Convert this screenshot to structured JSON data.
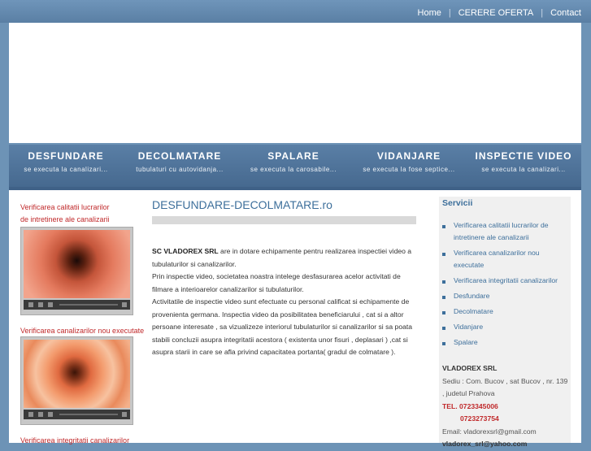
{
  "topnav": {
    "home": "Home",
    "cerere": "CERERE OFERTA",
    "contact": "Contact"
  },
  "nav": [
    {
      "title": "DESFUNDARE",
      "sub": "se executa la canalizari..."
    },
    {
      "title": "DECOLMATARE",
      "sub": "tubulaturi cu autovidanja..."
    },
    {
      "title": "SPALARE",
      "sub": "se executa la carosabile..."
    },
    {
      "title": "VIDANJARE",
      "sub": "se executa la fose septice..."
    },
    {
      "title": "INSPECTIE VIDEO",
      "sub": "se executa la canalizari..."
    }
  ],
  "left": {
    "video1_line1": "Verificarea calitatii lucrarilor",
    "video1_line2": "de intretinere ale canalizarii",
    "video2": "Verificarea canalizarilor nou executate",
    "video3": "Verificarea integritatii canalizarilor"
  },
  "main": {
    "heading": "DESFUNDARE-DECOLMATARE.ro",
    "company": "SC VLADOREX SRL",
    "p1": " are in dotare echipamente pentru realizarea inspectiei video a tubulaturilor si canalizarilor.",
    "p2": "Prin inspectie video, societatea noastra intelege desfasurarea acelor activitati de filmare a interioarelor canalizarilor si tubulaturilor.",
    "p3": "Activitatile de inspectie video sunt efectuate cu personal calificat si echipamente de provenienta germana. Inspectia video da posibilitatea beneficiarului , cat si a altor persoane interesate , sa vizualizeze interiorul tubulaturilor si canalizarilor si sa poata stabili concluzii asupra integritatii acestora ( existenta unor fisuri , deplasari ) ,cat si asupra starii in care se afla privind capacitatea portanta( gradul de colmatare )."
  },
  "sidebar": {
    "title": "Servicii",
    "items": [
      "Verificarea calitatii lucrarilor de intretinere ale canalizarii",
      "Verificarea canalizarilor nou executate",
      "Verificarea integritatii canalizarilor",
      "Desfundare",
      "Decolmatare",
      "Vidanjare",
      "Spalare"
    ],
    "company": "VLADOREX SRL",
    "address": "Sediu : Com. Bucov , sat Bucov , nr. 139 , judetul Prahova",
    "tel_label": "TEL. 0723345006",
    "tel2": "0723273754",
    "email_label": "Email: vladorexsrl@gmail.com",
    "email2": "vladorex_srl@yahoo.com"
  },
  "colors": {
    "accent": "#3d6f9b",
    "red": "#c0292b",
    "nav_bg": "#4f739a"
  }
}
